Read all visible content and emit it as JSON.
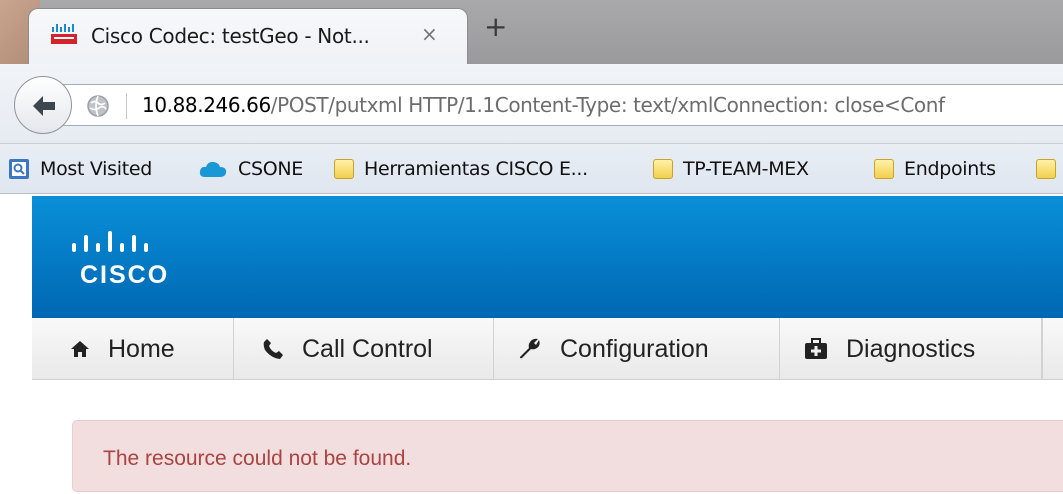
{
  "browser": {
    "tab": {
      "title": "Cisco Codec: testGeo - Not...",
      "close_glyph": "×",
      "favicon": "cisco-favicon"
    },
    "new_tab_glyph": "+",
    "url": {
      "host": "10.88.246.66",
      "rest": "/POST/putxml HTTP/1.1Content-Type: text/xmlConnection: close<Conf"
    },
    "bookmarks": [
      {
        "label": "Most Visited",
        "icon": "bookmarks-page-icon"
      },
      {
        "label": "CSONE",
        "icon": "salesforce-cloud-icon"
      },
      {
        "label": "Herramientas CISCO E...",
        "icon": "folder-icon"
      },
      {
        "label": "TP-TEAM-MEX",
        "icon": "folder-icon"
      },
      {
        "label": "Endpoints",
        "icon": "folder-icon"
      }
    ]
  },
  "app": {
    "brand": "CISCO",
    "colors": {
      "header_top": "#0a8fd8",
      "header_bottom": "#0067b3",
      "alert_bg": "#f2dede",
      "alert_text": "#a94442"
    },
    "menu": [
      {
        "label": "Home",
        "icon": "home-icon"
      },
      {
        "label": "Call Control",
        "icon": "phone-icon"
      },
      {
        "label": "Configuration",
        "icon": "wrench-icon"
      },
      {
        "label": "Diagnostics",
        "icon": "medkit-icon"
      }
    ],
    "alert": {
      "message": "The resource could not be found."
    }
  }
}
